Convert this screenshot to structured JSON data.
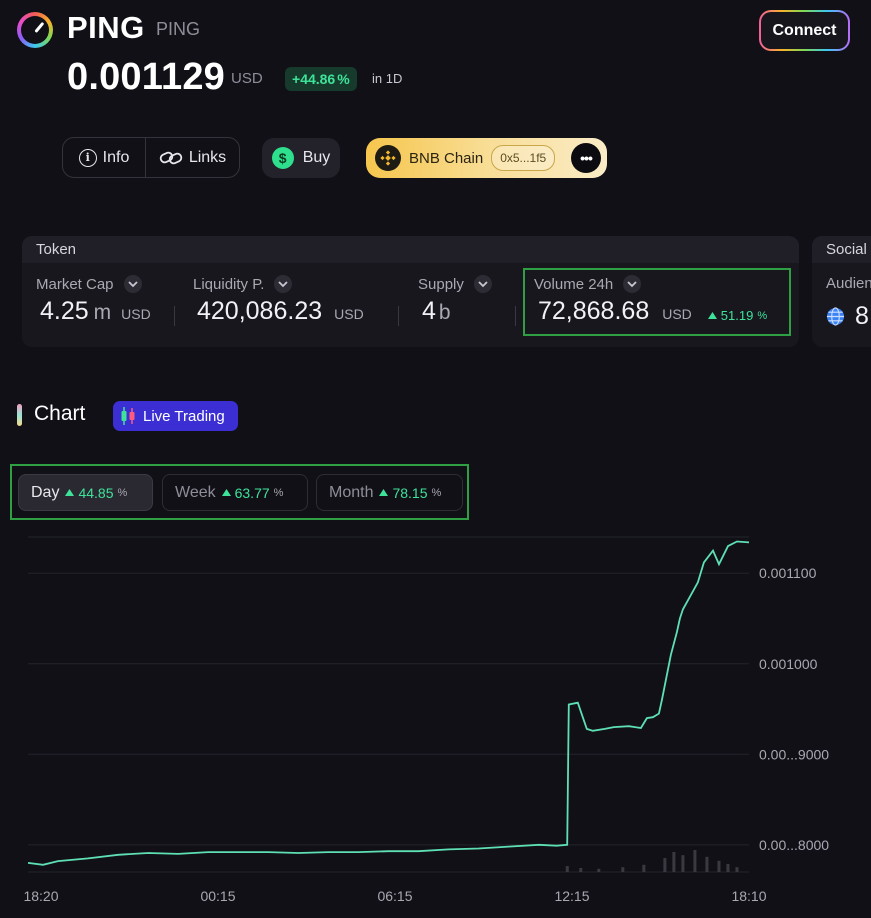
{
  "header": {
    "name": "PING",
    "ticker": "PING",
    "connect_label": "Connect",
    "price": "0.001129",
    "price_unit": "USD",
    "change_sign": "+",
    "change_value": "44.86",
    "change_pct": "%",
    "change_period": "in 1D"
  },
  "actions": {
    "info_label": "Info",
    "links_label": "Links",
    "buy_label": "Buy",
    "chain_label": "BNB Chain",
    "address": "0x5...1f5"
  },
  "token_panel": {
    "heading": "Token",
    "market_cap": {
      "label": "Market Cap",
      "value": "4.25",
      "suffix": "m",
      "unit": "USD"
    },
    "liquidity": {
      "label": "Liquidity P.",
      "value": "420,086.23",
      "unit": "USD"
    },
    "supply": {
      "label": "Supply",
      "value": "4",
      "suffix": "b"
    },
    "volume": {
      "label": "Volume 24h",
      "value": "72,868.68",
      "unit": "USD",
      "change": "51.19",
      "pct": "%"
    }
  },
  "social_panel": {
    "heading": "Social",
    "audience_label": "Audien",
    "audience_value": "8"
  },
  "chart_section": {
    "title": "Chart",
    "live_label": "Live Trading",
    "periods": [
      {
        "label": "Day",
        "change": "44.85",
        "pct": "%",
        "active": true
      },
      {
        "label": "Week",
        "change": "63.77",
        "pct": "%",
        "active": false
      },
      {
        "label": "Month",
        "change": "78.15",
        "pct": "%",
        "active": false
      }
    ]
  },
  "colors": {
    "accent_green": "#3ee39a",
    "line": "#5ee0b4",
    "live_trading": "#3b2fd3",
    "highlight_box": "#2ea043"
  },
  "chart_data": {
    "type": "line",
    "x_ticks": [
      "18:20",
      "00:15",
      "06:15",
      "12:15",
      "18:10"
    ],
    "y_ticks": [
      {
        "value": 0.0011,
        "label": "0.001100"
      },
      {
        "value": 0.001,
        "label": "0.001000"
      },
      {
        "value": 0.0009,
        "label": "0.00...9000"
      },
      {
        "value": 0.0008,
        "label": "0.00...8000"
      }
    ],
    "ylim": [
      0.00077,
      0.00114
    ],
    "xlim": [
      0,
      24
    ],
    "grid": true,
    "series": [
      {
        "x": [
          0,
          0.5,
          1,
          2,
          3,
          4,
          5,
          6,
          7,
          8,
          9,
          10,
          11,
          12,
          13,
          14,
          15,
          16,
          17,
          17.6,
          17.95,
          18.0,
          18.3,
          18.6,
          18.8,
          19.2,
          19.5,
          20.0,
          20.4,
          20.6,
          20.8,
          21.0,
          21.1,
          21.4,
          21.6,
          21.7,
          21.8,
          22.0,
          22.3,
          22.5,
          22.8,
          23.0,
          23.3,
          23.6,
          24
        ],
        "values": [
          0.00078,
          0.000778,
          0.000782,
          0.000785,
          0.000789,
          0.000791,
          0.00079,
          0.000792,
          0.000792,
          0.000792,
          0.000791,
          0.000792,
          0.000792,
          0.000793,
          0.000793,
          0.000795,
          0.000796,
          0.000798,
          0.0008,
          0.000799,
          0.0008,
          0.000955,
          0.000957,
          0.000928,
          0.000926,
          0.000928,
          0.00093,
          0.000931,
          0.000929,
          0.00094,
          0.000941,
          0.000945,
          0.00096,
          0.00101,
          0.001035,
          0.00105,
          0.00106,
          0.001072,
          0.00109,
          0.001112,
          0.001125,
          0.00111,
          0.00113,
          0.001135,
          0.001134
        ]
      }
    ],
    "volume_bars": {
      "x": [
        17.95,
        18.4,
        19.0,
        19.8,
        20.5,
        21.2,
        21.5,
        21.8,
        22.2,
        22.6,
        23.0,
        23.3,
        23.6
      ],
      "values": [
        0.15,
        0.1,
        0.08,
        0.12,
        0.18,
        0.35,
        0.5,
        0.42,
        0.55,
        0.38,
        0.28,
        0.2,
        0.12
      ]
    }
  }
}
